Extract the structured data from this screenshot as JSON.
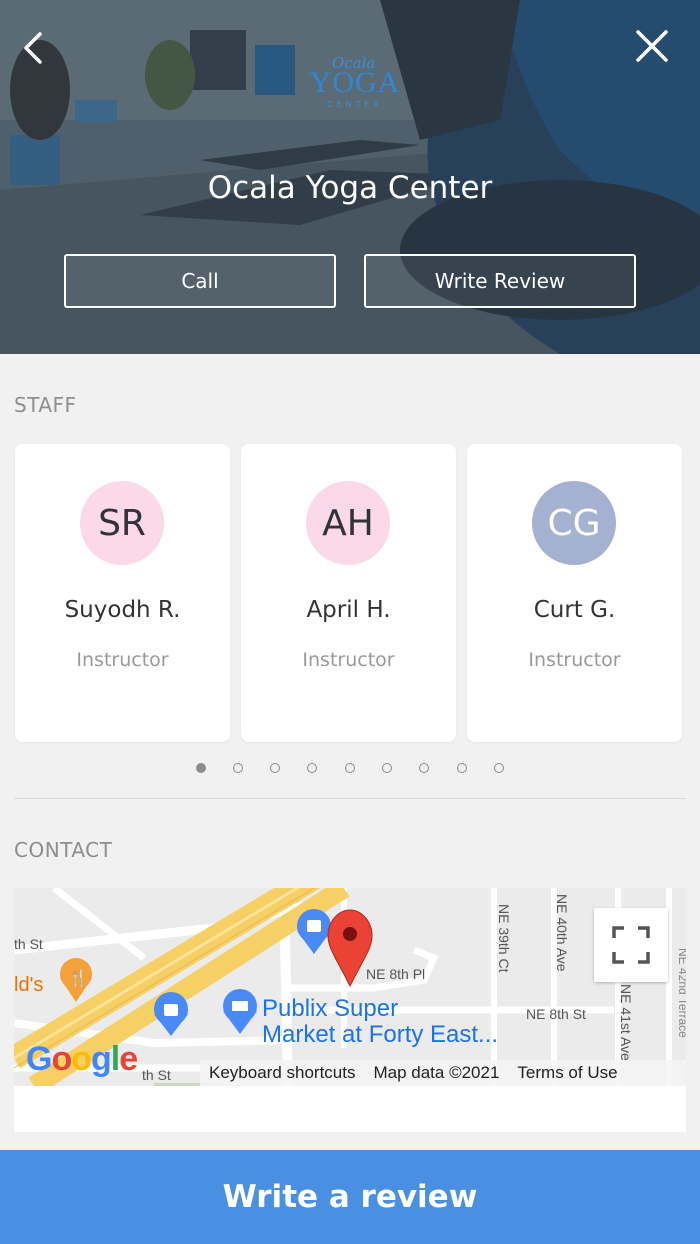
{
  "header": {
    "title": "Ocala Yoga Center",
    "logo": {
      "script": "Ocala",
      "main": "YOGA",
      "sub": "CENTER"
    },
    "call_label": "Call",
    "write_review_label": "Write Review"
  },
  "staff": {
    "section_label": "STAFF",
    "members": [
      {
        "initials": "SR",
        "name": "Suyodh R.",
        "role": "Instructor",
        "avatar_color": "#fbd9e8"
      },
      {
        "initials": "AH",
        "name": "April H.",
        "role": "Instructor",
        "avatar_color": "#fbd9e8"
      },
      {
        "initials": "CG",
        "name": "Curt G.",
        "role": "Instructor",
        "avatar_color": "#a5b1d0"
      }
    ],
    "carousel": {
      "pages": 9,
      "active": 1
    }
  },
  "contact": {
    "section_label": "CONTACT",
    "map": {
      "labels": {
        "th_st": "th St",
        "ne_8th_pl": "NE 8th Pl",
        "ne_8th_st": "NE 8th St",
        "ne_39th_ct": "NE 39th Ct",
        "ne_40th_ave": "NE 40th Ave",
        "ne_41st_ave": "NE 41st Ave",
        "ne_42nd_terrace": "NE 42nd Terrace",
        "lds": "ld's",
        "th_st_bottom": "th St",
        "publix": "Publix Super\nMarket at Forty East..."
      },
      "footer": {
        "keyboard": "Keyboard shortcuts",
        "data": "Map data ©2021",
        "terms": "Terms of Use"
      },
      "google_letters": [
        "G",
        "o",
        "o",
        "g",
        "l",
        "e"
      ]
    }
  },
  "cta": {
    "label": "Write a review"
  },
  "colors": {
    "accent": "#4a90e2",
    "pin": "#ea4335"
  }
}
